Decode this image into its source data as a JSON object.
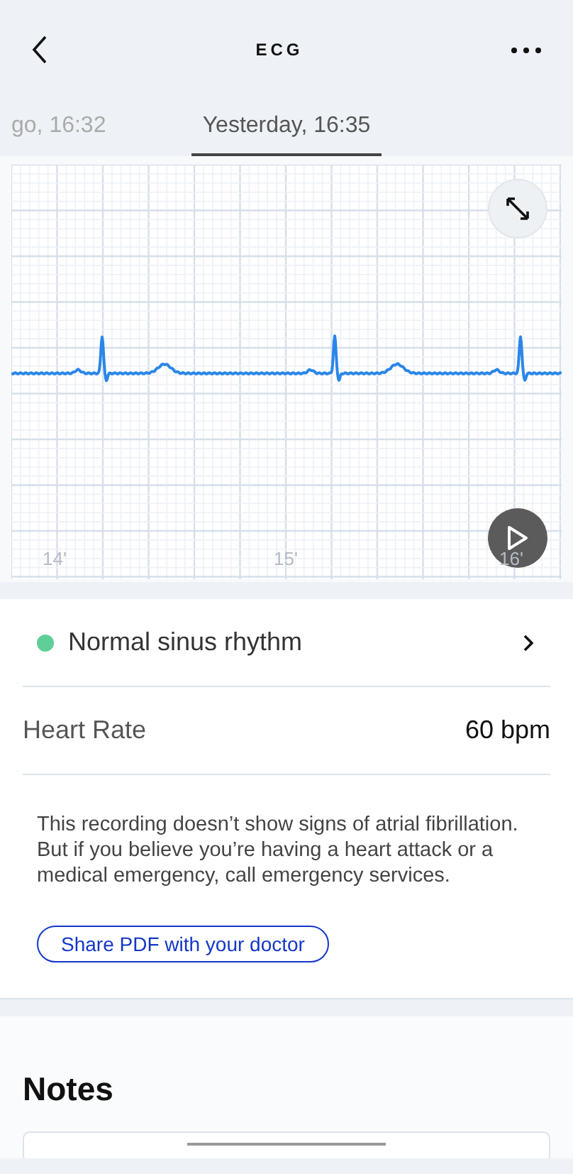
{
  "header": {
    "title": "ECG"
  },
  "tabs": [
    {
      "label": "go, 16:32",
      "selected": false
    },
    {
      "label": "Yesterday, 16:35",
      "selected": true
    }
  ],
  "chart": {
    "time_labels": [
      "14'",
      "15'",
      "16'"
    ]
  },
  "result": {
    "rhythm": "Normal sinus rhythm",
    "color": "#5ecf97"
  },
  "heart_rate": {
    "label": "Heart Rate",
    "value": "60 bpm"
  },
  "message": [
    "This recording doesn’t show signs of atrial fibrillation.",
    "But if you believe you’re having a heart attack or a medical emergency, call emergency services."
  ],
  "share_button": "Share PDF with your doctor",
  "notes": {
    "title": "Notes"
  }
}
